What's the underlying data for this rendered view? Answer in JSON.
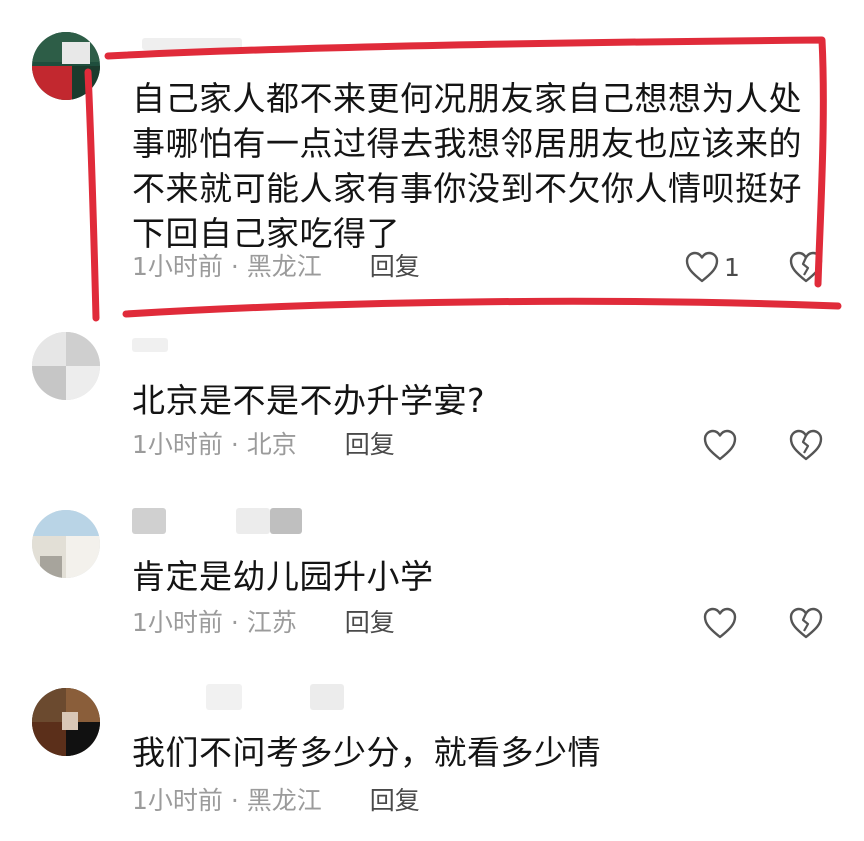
{
  "comments": [
    {
      "text": "自己家人都不来更何况朋友家自己想想为人处事哪怕有一点过得去我想邻居朋友也应该来的不来就可能人家有事你没到不欠你人情呗挺好下回自己家吃得了",
      "time": "1小时前",
      "sep": "·",
      "location": "黑龙江",
      "reply_label": "回复",
      "likes": "1",
      "like_icon": "heart-outline",
      "dislike_icon": "broken-heart-outline"
    },
    {
      "text": "北京是不是不办升学宴?",
      "time": "1小时前",
      "sep": "·",
      "location": "北京",
      "reply_label": "回复",
      "like_icon": "heart-outline",
      "dislike_icon": "broken-heart-outline"
    },
    {
      "text": "肯定是幼儿园升小学",
      "time": "1小时前",
      "sep": "·",
      "location": "江苏",
      "reply_label": "回复",
      "like_icon": "heart-outline",
      "dislike_icon": "broken-heart-outline"
    },
    {
      "text": "我们不问考多少分，就看多少情",
      "time": "1小时前",
      "sep": "·",
      "location": "黑龙江",
      "reply_label": "回复"
    }
  ],
  "colors": {
    "highlight_border": "#e02b3a",
    "text": "#141414",
    "meta": "#9b9b9b",
    "reply": "#4a4a4a",
    "icon": "#555555"
  }
}
